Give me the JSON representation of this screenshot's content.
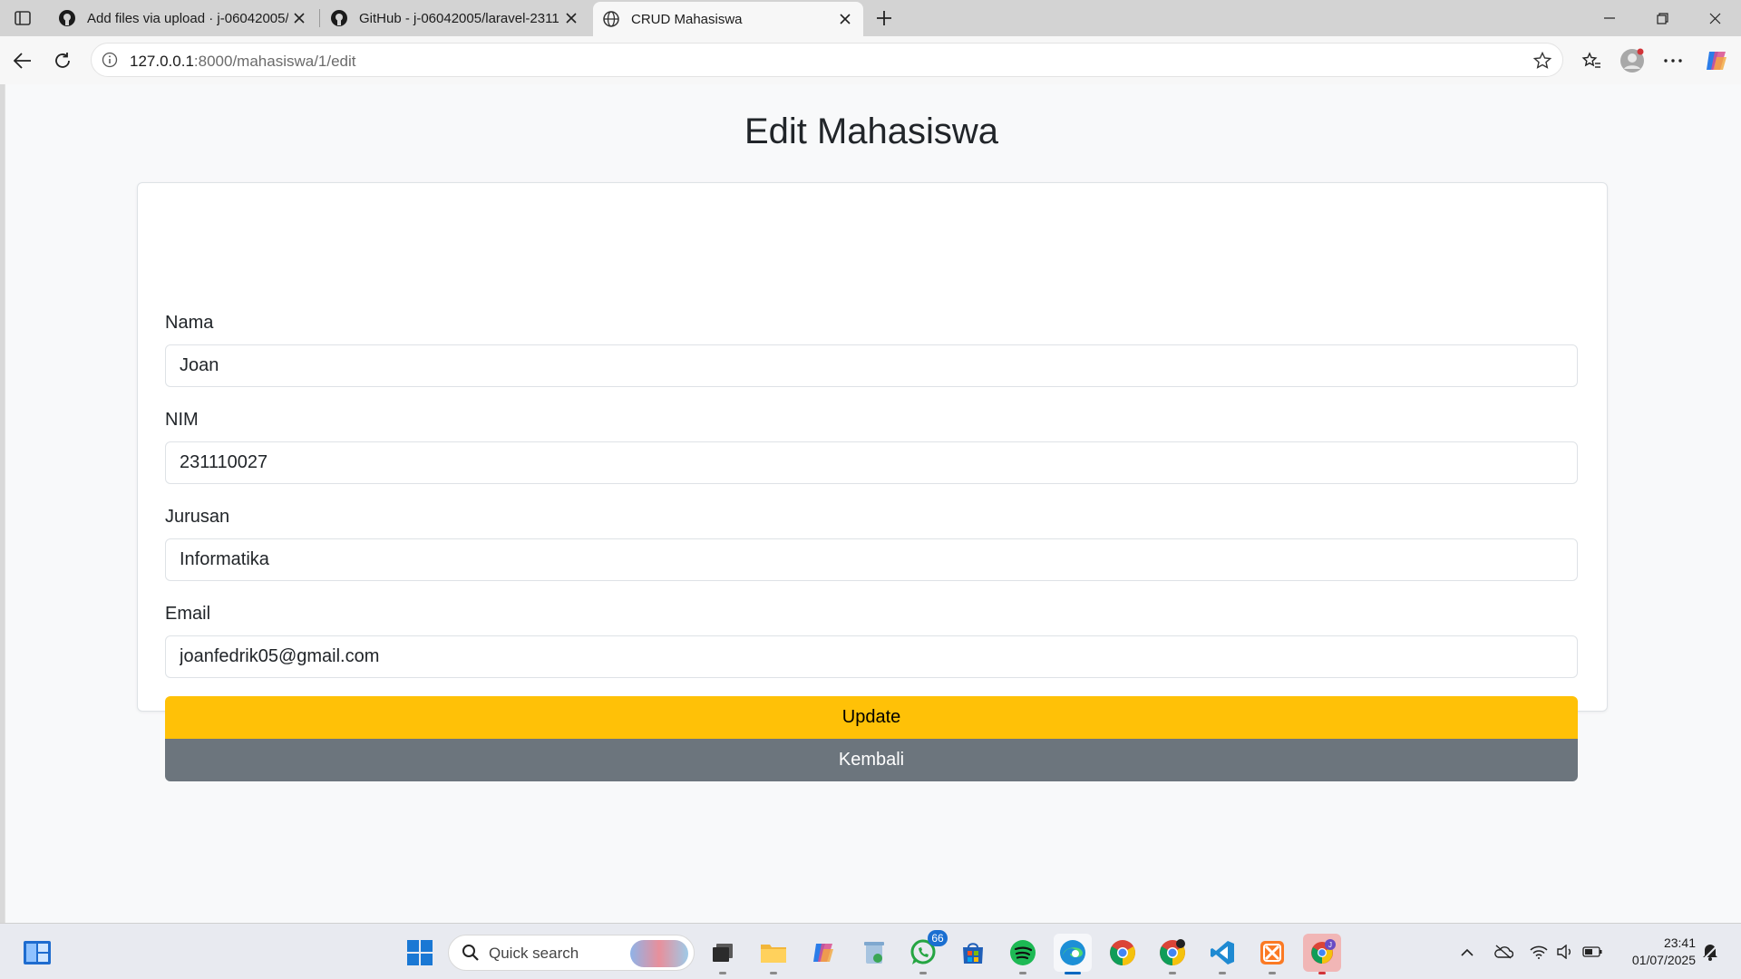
{
  "browser": {
    "tabs": [
      {
        "title": "Add files via upload · j-06042005/",
        "icon": "github-icon"
      },
      {
        "title": "GitHub - j-06042005/laravel-2311",
        "icon": "github-icon"
      },
      {
        "title": "CRUD Mahasiswa",
        "icon": "globe-icon"
      }
    ],
    "url_host": "127.0.0.1",
    "url_rest": ":8000/mahasiswa/1/edit"
  },
  "page": {
    "title": "Edit Mahasiswa",
    "fields": {
      "nama": {
        "label": "Nama",
        "value": "Joan"
      },
      "nim": {
        "label": "NIM",
        "value": "231110027"
      },
      "jurusan": {
        "label": "Jurusan",
        "value": "Informatika"
      },
      "email": {
        "label": "Email",
        "value": "joanfedrik05@gmail.com"
      }
    },
    "update_label": "Update",
    "back_label": "Kembali"
  },
  "taskbar": {
    "search_placeholder": "Quick search",
    "whatsapp_badge": "66",
    "time": "23:41",
    "date": "01/07/2025"
  },
  "colors": {
    "update": "#ffc107",
    "back": "#6c757d",
    "accent": "#0067c0"
  }
}
